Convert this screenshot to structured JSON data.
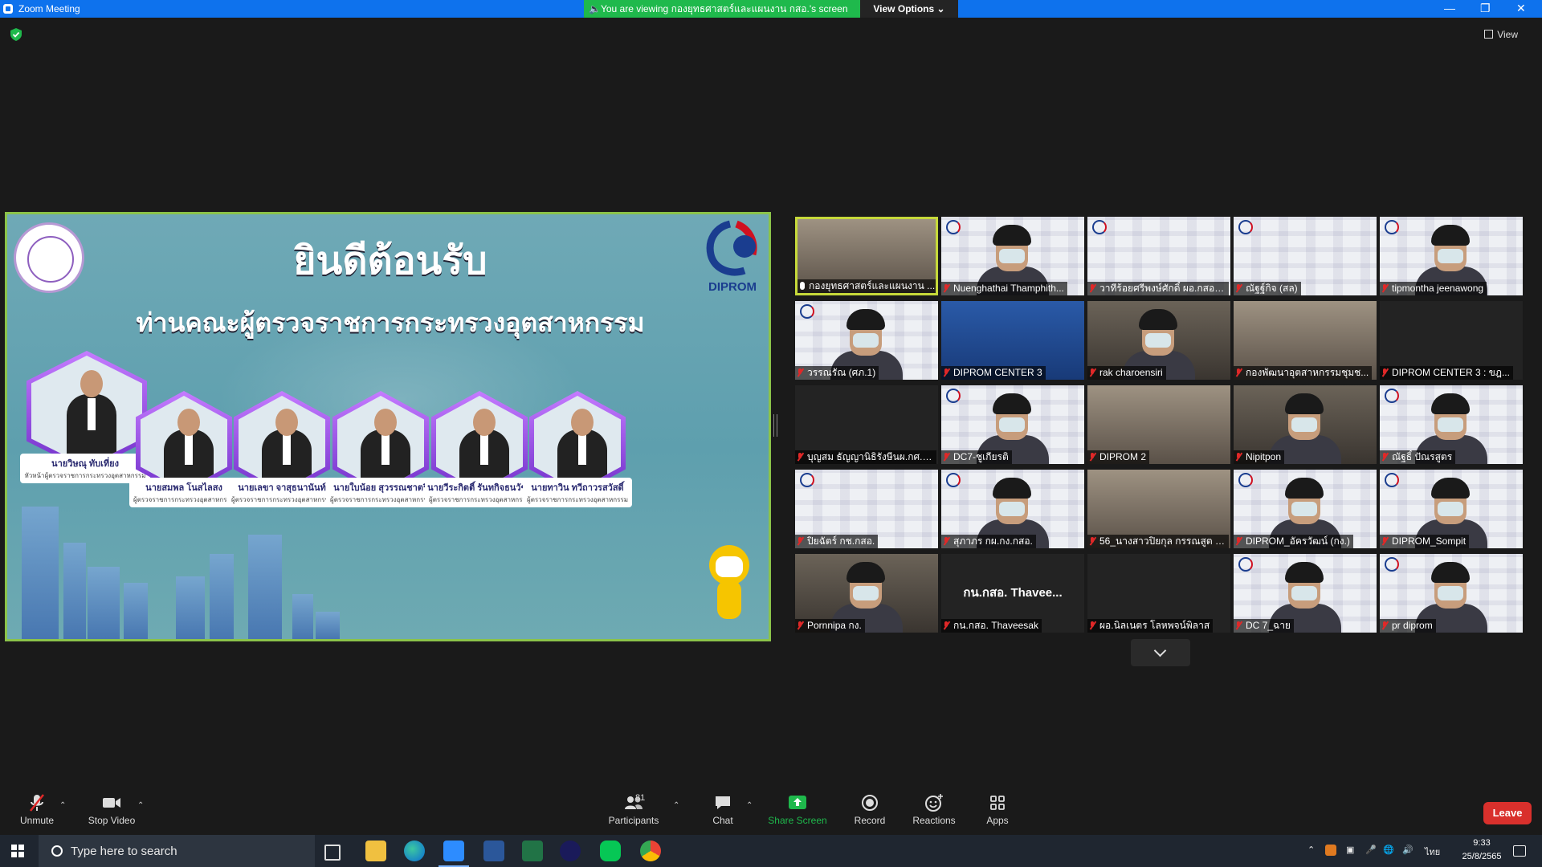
{
  "window": {
    "title": "Zoom Meeting",
    "viewing_banner": "You are viewing กองยุทธศาสตร์และแผนงาน กสอ.'s screen",
    "view_options": "View Options",
    "view_button": "View"
  },
  "slide": {
    "title": "ยินดีต้อนรับ",
    "subtitle": "ท่านคณะผู้ตรวจราชการกระทรวงอุตสาหกรรม",
    "logo_text": "DIPROM",
    "people": [
      {
        "name": "นายวิษณุ ทับเที่ยง",
        "role": "หัวหน้าผู้ตรวจราชการกระทรวงอุตสาหกรรม"
      },
      {
        "name": "นายสมพล โนสไลสง",
        "role": "ผู้ตรวจราชการกระทรวงอุตสาหกรรม"
      },
      {
        "name": "นายเลขา จาสุธนานันท์",
        "role": "ผู้ตรวจราชการกระทรวงอุตสาหกรรม"
      },
      {
        "name": "นายใบน้อย สุวรรณชาตรี",
        "role": "ผู้ตรวจราชการกระทรวงอุตสาหกรรม"
      },
      {
        "name": "นายวีระกิตติ์ รันทกิจธนวัชร",
        "role": "ผู้ตรวจราชการกระทรวงอุตสาหกรรม"
      },
      {
        "name": "นายทาวิน ทวีถาวรสวัสดิ์",
        "role": "ผู้ตรวจราชการกระทรวงอุตสาหกรรม"
      }
    ]
  },
  "gallery": {
    "tiles": [
      {
        "label": "กองยุทธศาสตร์และแผนงาน ...",
        "muted": false,
        "style": "office",
        "selected": true
      },
      {
        "label": "Nuenghathai Thamphith...",
        "muted": true,
        "style": "white",
        "face": true
      },
      {
        "label": "วาทีร้อยศรีพงษ์ศักดิ์ ผอ.กสอ.ก...",
        "muted": true,
        "style": "white"
      },
      {
        "label": "ณัฐฐ์กิจ (สล)",
        "muted": true,
        "style": "white"
      },
      {
        "label": "tipmontha jeenawong",
        "muted": true,
        "style": "white",
        "face": true
      },
      {
        "label": "วรรณรัณ (ศภ.1)",
        "muted": true,
        "style": "white",
        "face": true
      },
      {
        "label": "DIPROM CENTER 3",
        "muted": true,
        "style": "blue"
      },
      {
        "label": "rak charoensiri",
        "muted": true,
        "style": "photo",
        "face": true
      },
      {
        "label": "กองพัฒนาอุตสาหกรรมชุมช...",
        "muted": true,
        "style": "office"
      },
      {
        "label": "DIPROM CENTER 3 : ขฎ...",
        "muted": true,
        "style": "dark"
      },
      {
        "label": "บุญสม ธัญญานิธิรังษีนผ.กศ.1...",
        "muted": true,
        "style": "dark"
      },
      {
        "label": "DC7-ชูเกียรติ",
        "muted": true,
        "style": "white",
        "face": true
      },
      {
        "label": "DIPROM 2",
        "muted": true,
        "style": "office"
      },
      {
        "label": "Nipitpon",
        "muted": true,
        "style": "photo",
        "face": true
      },
      {
        "label": "ณัฐธิ์ ปัณรสูตร",
        "muted": true,
        "style": "white",
        "face": true
      },
      {
        "label": "ปิยฉัตร์ กช.กสอ.",
        "muted": true,
        "style": "white"
      },
      {
        "label": "สุภาภร กผ.กง.กสอ.",
        "muted": true,
        "style": "white",
        "face": true
      },
      {
        "label": "56_นางสาวปิยกุล กรรณสูต (...",
        "muted": true,
        "style": "office"
      },
      {
        "label": "DIPROM_อัครวัฒน์ (กง.)",
        "muted": true,
        "style": "white",
        "face": true
      },
      {
        "label": "DIPROM_Sompit",
        "muted": true,
        "style": "white",
        "face": true
      },
      {
        "label": "Pornnipa กง.",
        "muted": true,
        "style": "photo",
        "face": true
      },
      {
        "label": "กน.กสอ. Thaveesak",
        "muted": true,
        "style": "dark",
        "card": "กน.กสอ. Thavee..."
      },
      {
        "label": "ผอ.นิลเนตร โลหพจน์พิลาส",
        "muted": true,
        "style": "dark"
      },
      {
        "label": "DC 7_ฉาย",
        "muted": true,
        "style": "white",
        "face": true
      },
      {
        "label": "pr diprom",
        "muted": true,
        "style": "white",
        "face": true
      }
    ]
  },
  "toolbar": {
    "unmute": "Unmute",
    "stop_video": "Stop Video",
    "participants": "Participants",
    "participants_count": "81",
    "chat": "Chat",
    "share_screen": "Share Screen",
    "record": "Record",
    "reactions": "Reactions",
    "apps": "Apps",
    "leave": "Leave",
    "share_color": "#1fb94c",
    "leave_color": "#d9302c"
  },
  "taskbar": {
    "search_placeholder": "Type here to search",
    "time": "9:33",
    "date": "25/8/2565",
    "lang": "ไทย"
  }
}
